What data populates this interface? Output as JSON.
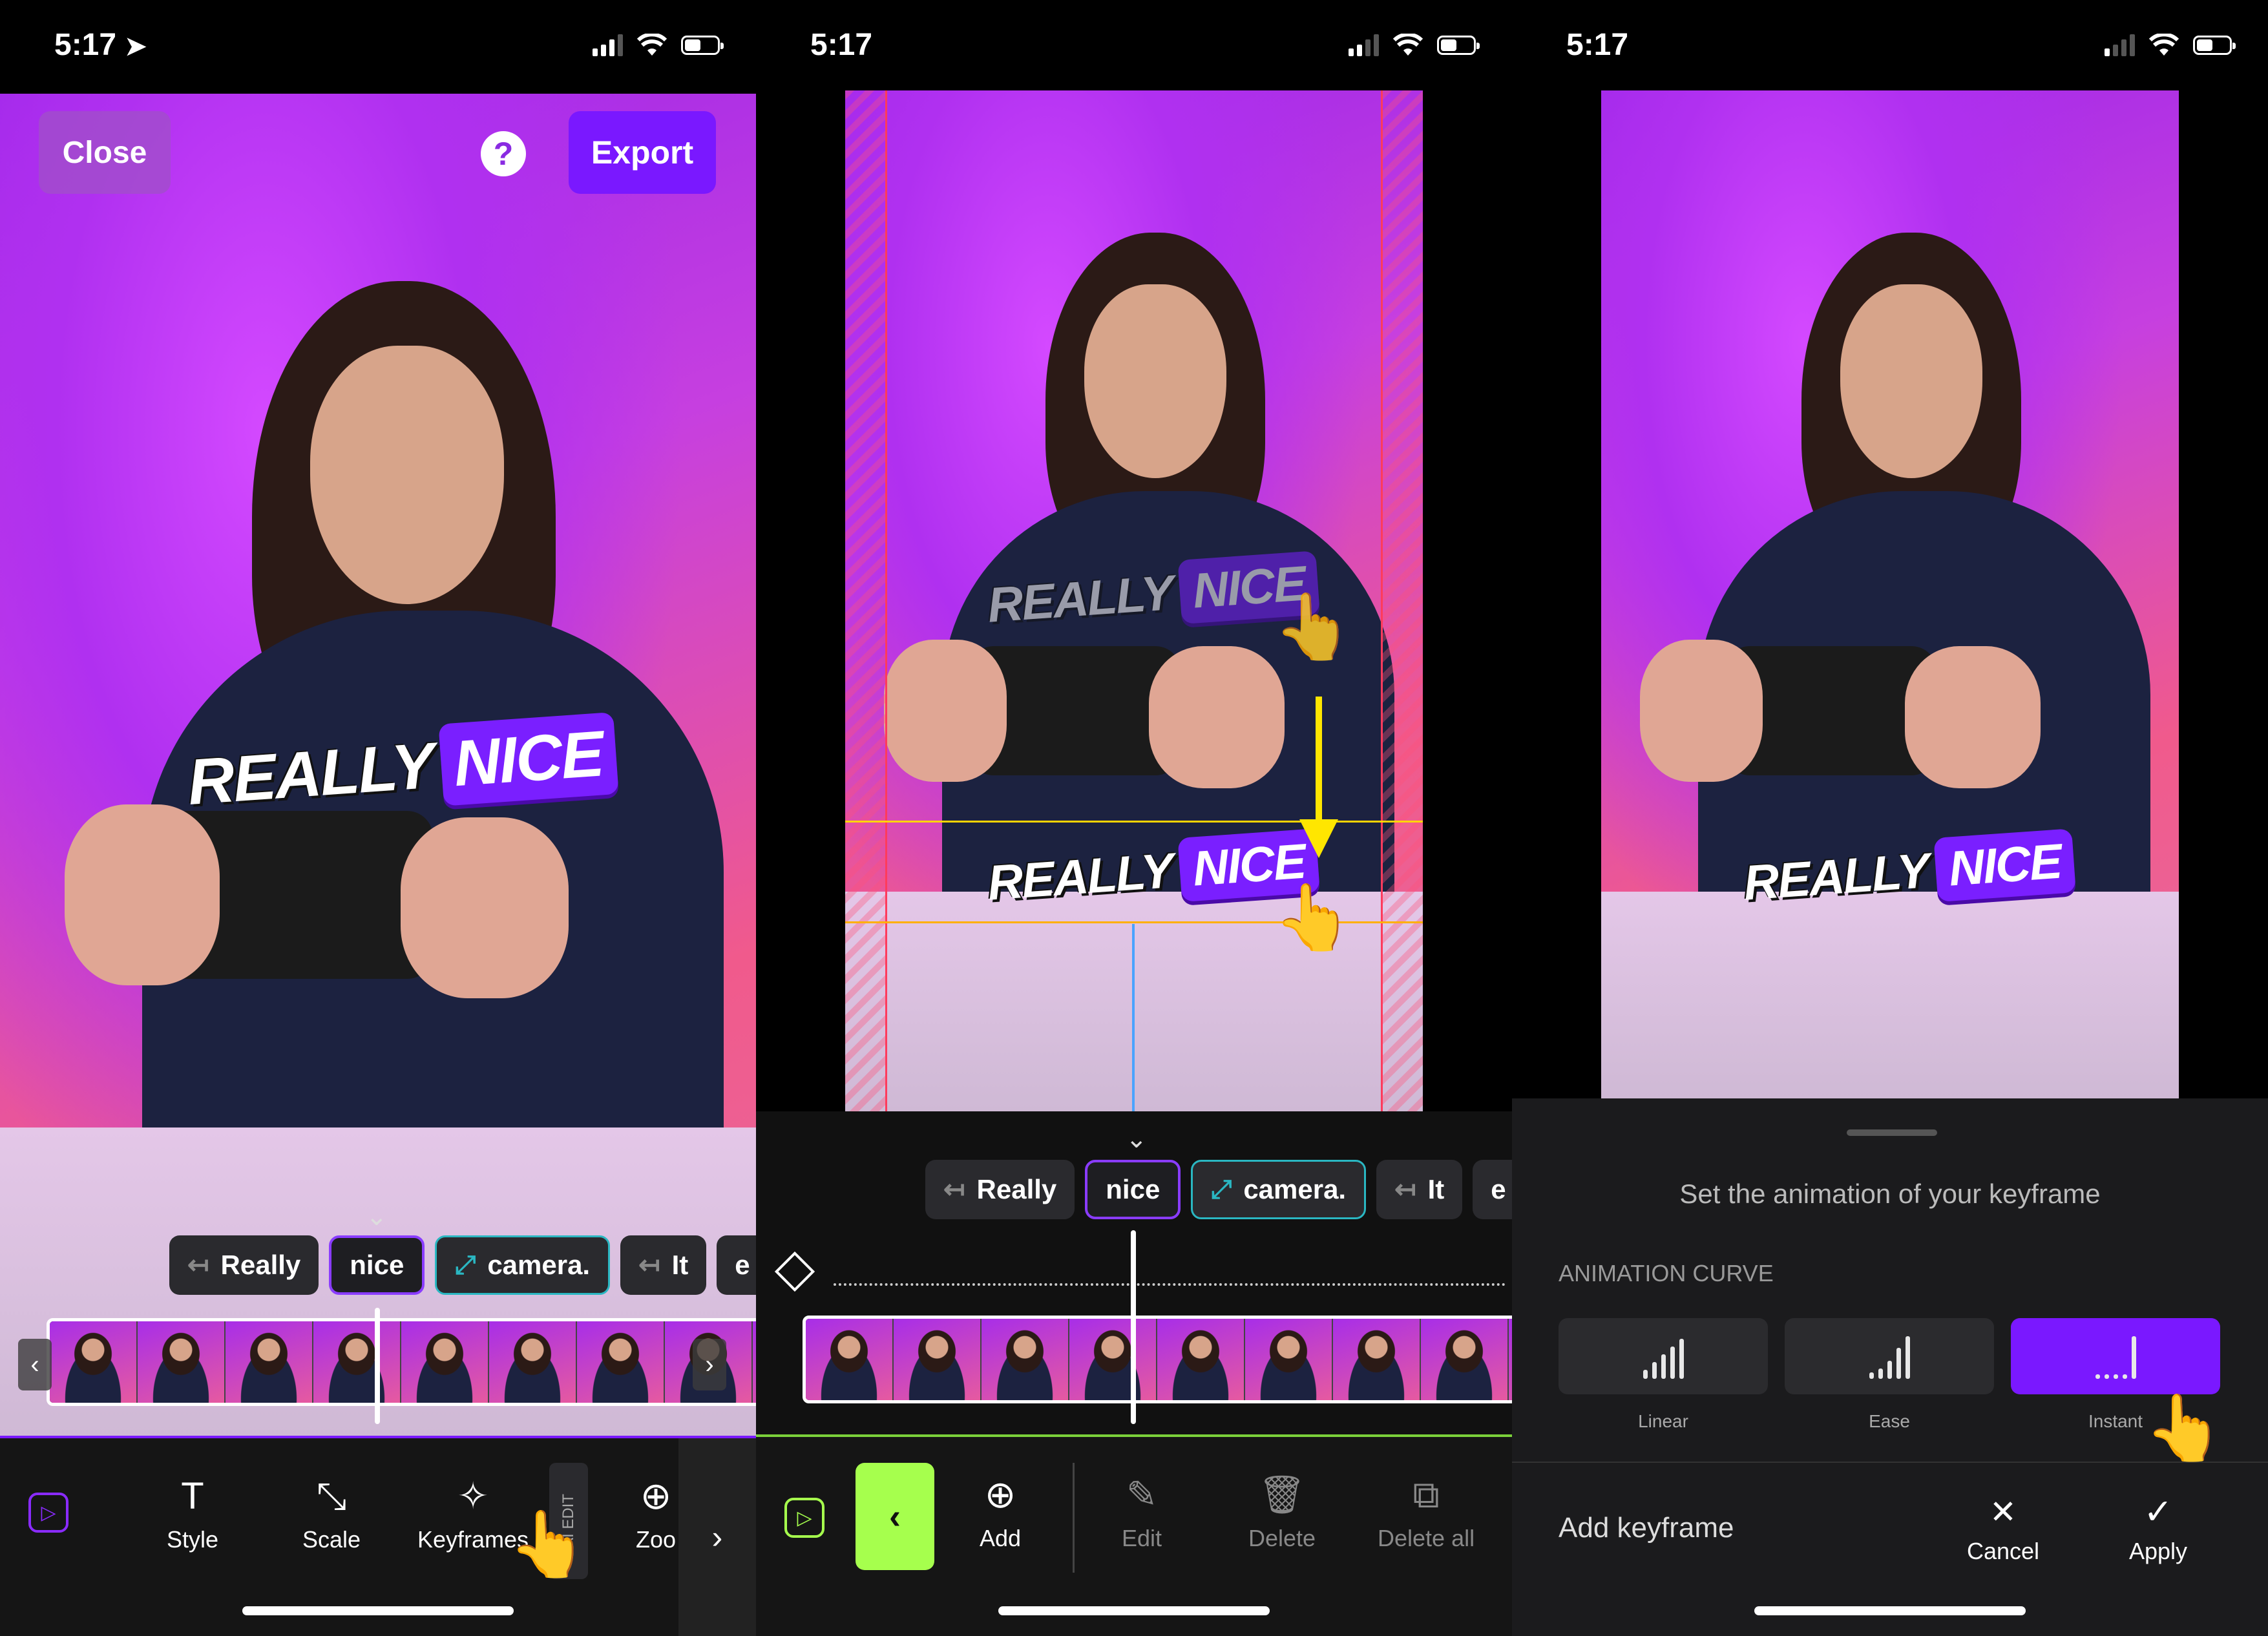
{
  "status": {
    "time": "5:17"
  },
  "panel1": {
    "close_label": "Close",
    "export_label": "Export",
    "help_glyph": "?",
    "caption": {
      "word1": "REALLY",
      "word2": "NICE"
    },
    "chips": [
      "Really",
      "nice",
      "camera.",
      "It",
      "e"
    ],
    "toolbar": {
      "style": "Style",
      "scale": "Scale",
      "keyframes": "Keyframes",
      "ai_edit": "AI EDIT",
      "zoom": "Zoo"
    }
  },
  "panel2": {
    "caption": {
      "word1": "REALLY",
      "word2": "NICE"
    },
    "chips": [
      "Really",
      "nice",
      "camera.",
      "It",
      "e"
    ],
    "toolbar": {
      "add": "Add",
      "edit": "Edit",
      "delete": "Delete",
      "delete_all": "Delete all"
    }
  },
  "panel3": {
    "caption": {
      "word1": "REALLY",
      "word2": "NICE"
    },
    "sheet_title": "Set the animation of your keyframe",
    "section_label": "ANIMATION CURVE",
    "curves": [
      {
        "label": "Linear",
        "active": false
      },
      {
        "label": "Ease",
        "active": false
      },
      {
        "label": "Instant",
        "active": true
      }
    ],
    "add_keyframe": "Add keyframe",
    "cancel": "Cancel",
    "apply": "Apply"
  },
  "colors": {
    "accent": "#7a18ff",
    "lime": "#a6ff4d",
    "teal": "#2ab7c2",
    "guide_yellow": "#ffd400",
    "guide_red": "#ff3b5c"
  },
  "icons": [
    "location-arrow-icon",
    "signal-icon",
    "wifi-icon",
    "battery-icon",
    "help-icon",
    "play-icon",
    "text-icon",
    "scale-icon",
    "keyframes-icon",
    "zoom-icon",
    "chevron-right-icon",
    "chevron-left-icon",
    "add-icon",
    "edit-icon",
    "delete-icon",
    "delete-all-icon",
    "diamond-icon",
    "close-icon",
    "check-icon",
    "hand-pointer-icon"
  ]
}
